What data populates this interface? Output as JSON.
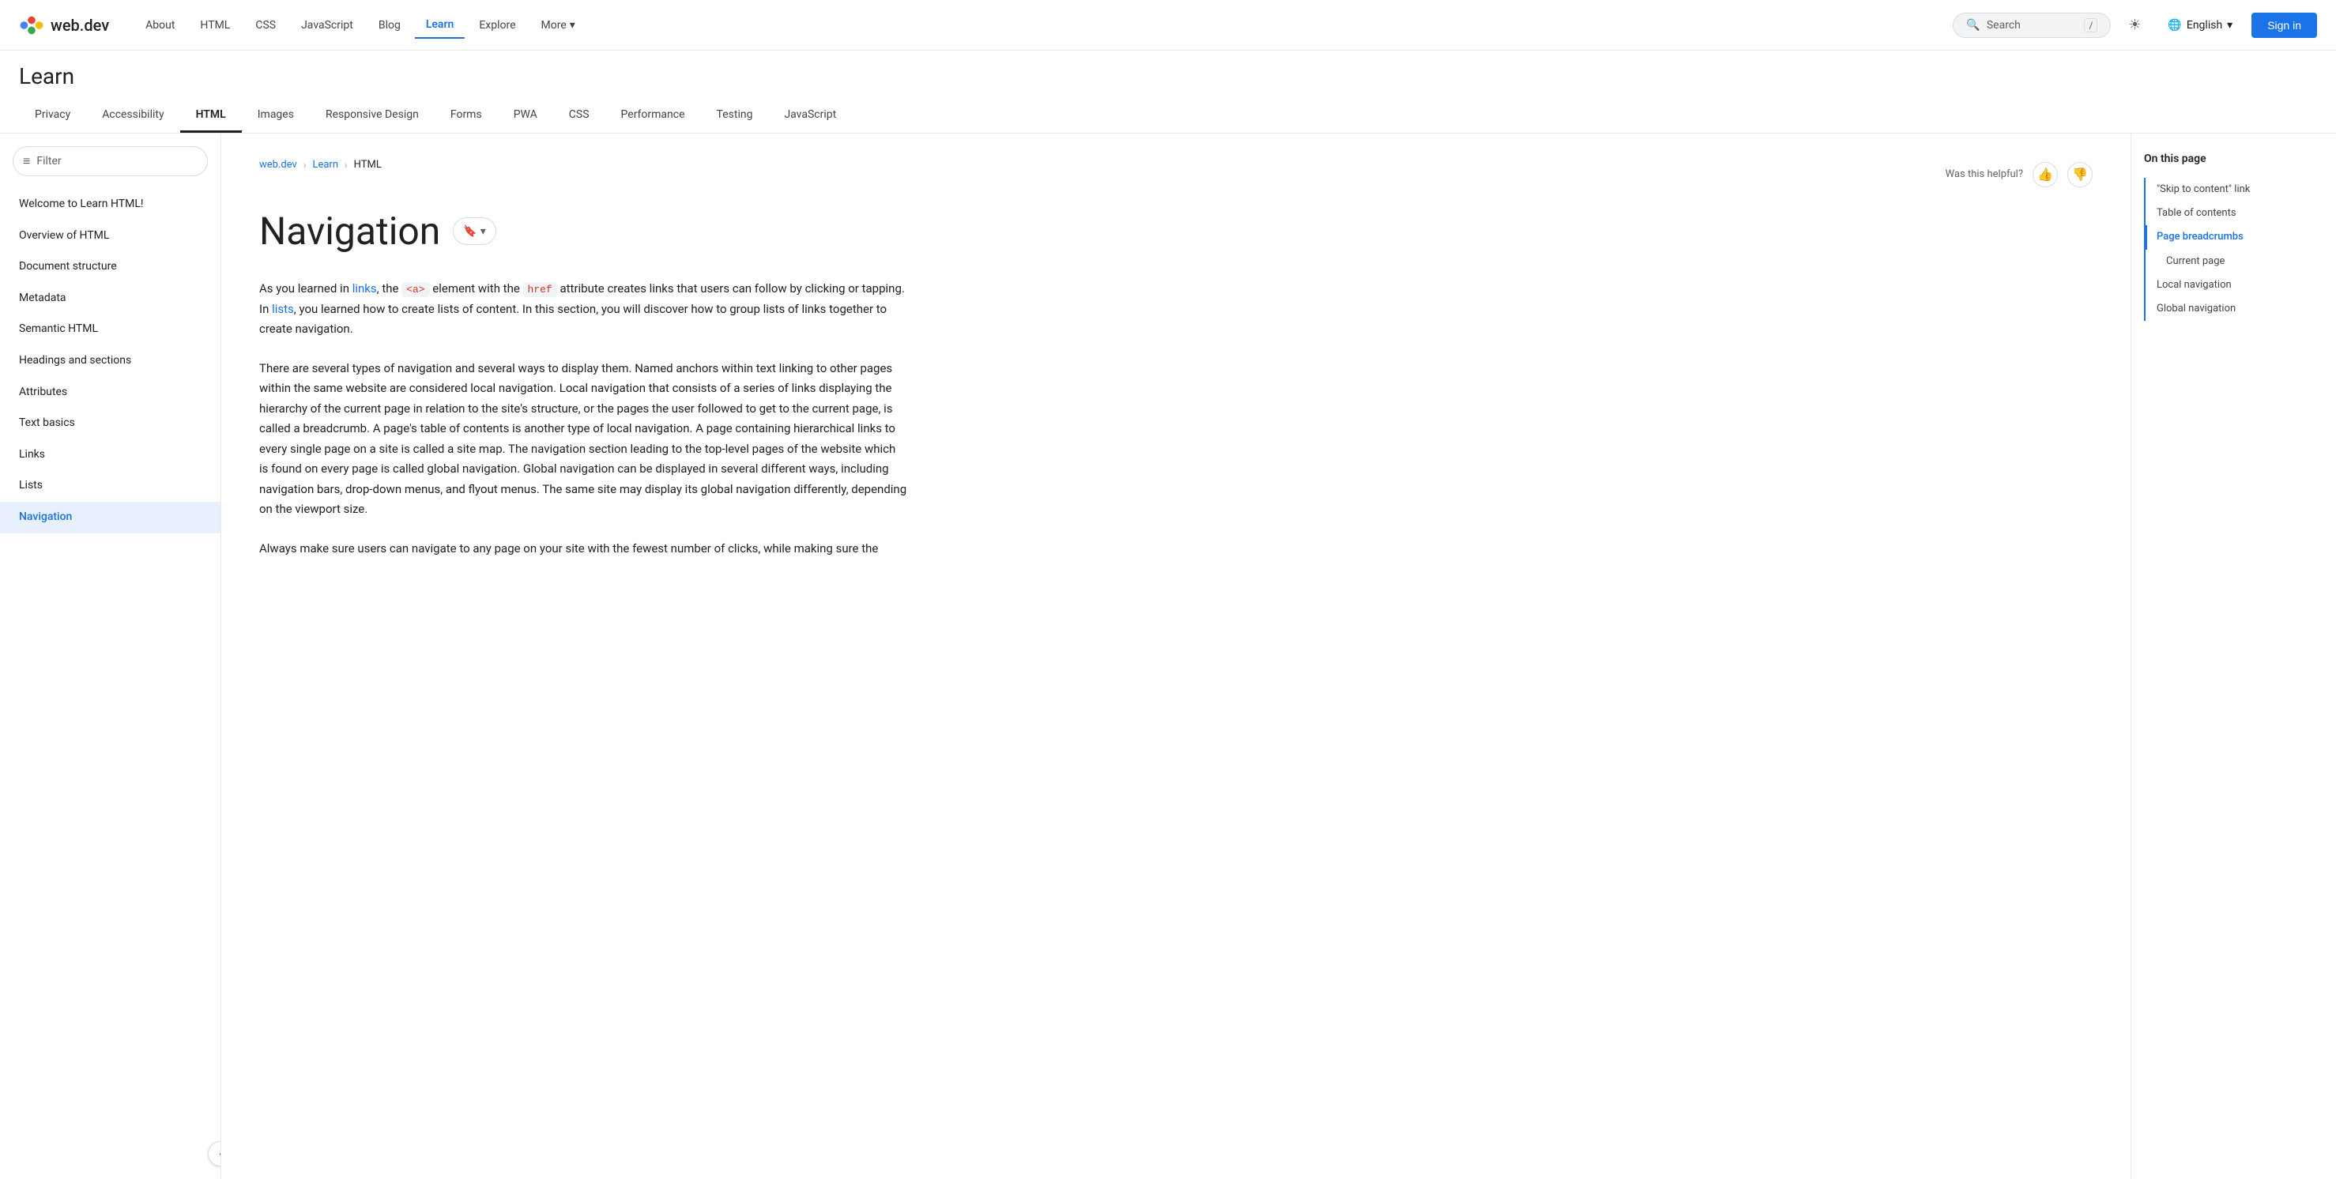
{
  "site": {
    "logo_text": "web.dev",
    "logo_icon": "▶"
  },
  "topnav": {
    "links": [
      {
        "label": "About",
        "active": false
      },
      {
        "label": "HTML",
        "active": false
      },
      {
        "label": "CSS",
        "active": false
      },
      {
        "label": "JavaScript",
        "active": false
      },
      {
        "label": "Blog",
        "active": false
      },
      {
        "label": "Learn",
        "active": true
      },
      {
        "label": "Explore",
        "active": false
      },
      {
        "label": "More",
        "active": false,
        "dropdown": true
      }
    ],
    "search_placeholder": "Search",
    "search_shortcut": "/",
    "language": "English",
    "sign_in": "Sign in"
  },
  "learn_header": {
    "title": "Learn",
    "tabs": [
      {
        "label": "Privacy",
        "active": false
      },
      {
        "label": "Accessibility",
        "active": false
      },
      {
        "label": "HTML",
        "active": true
      },
      {
        "label": "Images",
        "active": false
      },
      {
        "label": "Responsive Design",
        "active": false
      },
      {
        "label": "Forms",
        "active": false
      },
      {
        "label": "PWA",
        "active": false
      },
      {
        "label": "CSS",
        "active": false
      },
      {
        "label": "Performance",
        "active": false
      },
      {
        "label": "Testing",
        "active": false
      },
      {
        "label": "JavaScript",
        "active": false
      }
    ]
  },
  "sidebar": {
    "filter_placeholder": "Filter",
    "items": [
      {
        "label": "Welcome to Learn HTML!",
        "active": false
      },
      {
        "label": "Overview of HTML",
        "active": false
      },
      {
        "label": "Document structure",
        "active": false
      },
      {
        "label": "Metadata",
        "active": false
      },
      {
        "label": "Semantic HTML",
        "active": false
      },
      {
        "label": "Headings and sections",
        "active": false
      },
      {
        "label": "Attributes",
        "active": false
      },
      {
        "label": "Text basics",
        "active": false
      },
      {
        "label": "Links",
        "active": false
      },
      {
        "label": "Lists",
        "active": false
      },
      {
        "label": "Navigation",
        "active": true
      }
    ],
    "collapse_icon": "‹"
  },
  "content": {
    "breadcrumb": {
      "home": "web.dev",
      "section": "Learn",
      "page": "HTML"
    },
    "helpful_text": "Was this helpful?",
    "title": "Navigation",
    "bookmark_label": "🔖",
    "bookmark_dropdown": "▾",
    "paragraphs": [
      "As you learned in links, the <a> element with the href attribute creates links that users can follow by clicking or tapping. In lists, you learned how to create lists of content. In this section, you will discover how to group lists of links together to create navigation.",
      "There are several types of navigation and several ways to display them. Named anchors within text linking to other pages within the same website are considered local navigation. Local navigation that consists of a series of links displaying the hierarchy of the current page in relation to the site's structure, or the pages the user followed to get to the current page, is called a breadcrumb. A page's table of contents is another type of local navigation. A page containing hierarchical links to every single page on a site is called a site map. The navigation section leading to the top-level pages of the website which is found on every page is called global navigation. Global navigation can be displayed in several different ways, including navigation bars, drop-down menus, and flyout menus. The same site may display its global navigation differently, depending on the viewport size.",
      "Always make sure users can navigate to any page on your site with the fewest number of clicks, while making sure the"
    ],
    "inline_links": [
      {
        "text": "links",
        "href": "#"
      },
      {
        "text": "lists",
        "href": "#"
      }
    ],
    "inline_code": [
      "<a>",
      "href"
    ]
  },
  "toc": {
    "title": "On this page",
    "items": [
      {
        "label": "\"Skip to content\" link",
        "active": false,
        "sub": false
      },
      {
        "label": "Table of contents",
        "active": false,
        "sub": false
      },
      {
        "label": "Page breadcrumbs",
        "active": true,
        "sub": false
      },
      {
        "label": "Current page",
        "active": false,
        "sub": true
      },
      {
        "label": "Local navigation",
        "active": false,
        "sub": false
      },
      {
        "label": "Global navigation",
        "active": false,
        "sub": false
      }
    ]
  }
}
